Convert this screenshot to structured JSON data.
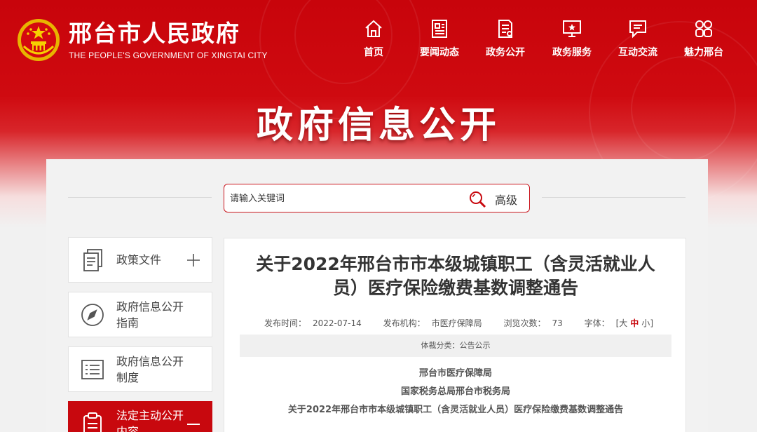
{
  "header": {
    "site_title": "邢台市人民政府",
    "site_subtitle": "THE PEOPLE'S GOVERNMENT OF XINGTAI CITY",
    "nav": [
      {
        "label": "首页",
        "icon": "home-icon"
      },
      {
        "label": "要闻动态",
        "icon": "news-icon"
      },
      {
        "label": "政务公开",
        "icon": "document-icon"
      },
      {
        "label": "政务服务",
        "icon": "monitor-star-icon"
      },
      {
        "label": "互动交流",
        "icon": "chat-icon"
      },
      {
        "label": "魅力邢台",
        "icon": "grid-icon"
      }
    ]
  },
  "banner": {
    "title": "政府信息公开"
  },
  "search": {
    "placeholder": "请输入关键词",
    "advanced_label": "高级"
  },
  "sidebar": {
    "items": [
      {
        "label": "政策文件",
        "icon": "files-icon",
        "toggle": "+"
      },
      {
        "label": "政府信息公开指南",
        "icon": "compass-icon"
      },
      {
        "label": "政府信息公开制度",
        "icon": "list-icon"
      },
      {
        "label": "法定主动公开内容",
        "icon": "clipboard-icon",
        "toggle": "−"
      }
    ]
  },
  "article": {
    "title": "关于2022年邢台市市本级城镇职工（含灵活就业人员）医疗保险缴费基数调整通告",
    "meta": {
      "publish_time_label": "发布时间：",
      "publish_time": "2022-07-14",
      "publisher_label": "发布机构：",
      "publisher": "市医疗保障局",
      "views_label": "浏览次数：",
      "views": "73",
      "font_label": "字体：",
      "font_options": [
        "大",
        "中",
        "小"
      ],
      "font_current": "中"
    },
    "category": "体裁分类：公告公示",
    "body_lines": [
      "邢台市医疗保障局",
      "国家税务总局邢台市税务局",
      "关于2022年邢台市市本级城镇职工（含灵活就业人员）医疗保险缴费基数调整通告"
    ]
  },
  "colors": {
    "brand_red": "#c8080e",
    "panel_bg": "#f2f2f2"
  }
}
